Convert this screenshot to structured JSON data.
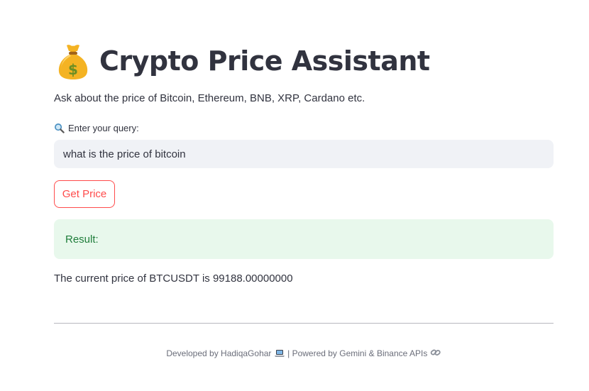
{
  "header": {
    "title": "Crypto Price Assistant",
    "title_icon": "moneybag-icon"
  },
  "subtitle": "Ask about the price of Bitcoin, Ethereum, BNB, XRP, Cardano etc.",
  "query": {
    "label_icon": "magnifier-icon",
    "label": "Enter your query:",
    "value": "what is the price of bitcoin"
  },
  "button": {
    "label": "Get Price"
  },
  "result": {
    "label": "Result:",
    "text": "The current price of BTCUSDT is 99188.00000000"
  },
  "footer": {
    "part1": "Developed by HadiqaGohar",
    "part1_icon": "laptop-icon",
    "separator": " | ",
    "part2": "Powered by Gemini & Binance APIs",
    "part2_icon": "link-icon"
  },
  "colors": {
    "accent": "#ff4b4b",
    "input_bg": "#f0f2f6",
    "success_bg": "#e8f8ec",
    "success_text": "#1e7d3a",
    "text": "#31333f"
  }
}
